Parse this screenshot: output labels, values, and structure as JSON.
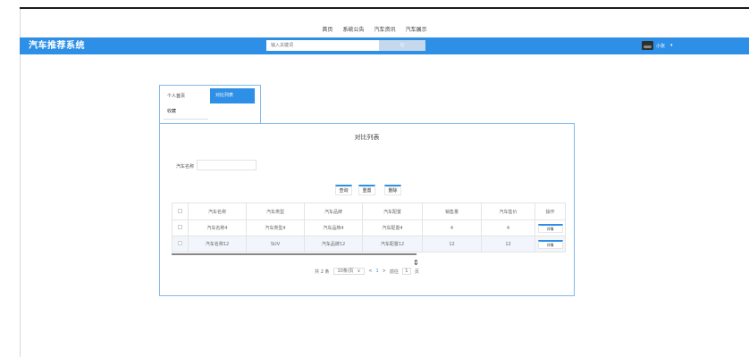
{
  "top_nav": {
    "items": [
      "首页",
      "系统公告",
      "汽车资讯",
      "汽车展示"
    ]
  },
  "header": {
    "brand": "汽车推荐系统",
    "search_placeholder": "输入关键词",
    "search_button": "Q",
    "user_name": "小张",
    "user_caret": "▾"
  },
  "side_tabs": {
    "profile": "个人首页",
    "compare": "对比列表",
    "favorites": "收藏"
  },
  "main": {
    "title": "对比列表",
    "filter_label": "汽车名称",
    "filter_value": "",
    "buttons": {
      "query": "查询",
      "reset": "重置",
      "delete": "删除"
    },
    "columns": [
      "",
      "汽车名称",
      "汽车类型",
      "汽车品牌",
      "汽车配置",
      "销售量",
      "汽车售价",
      "操作"
    ],
    "rows": [
      {
        "name": "汽车名称4",
        "type": "汽车类型4",
        "brand": "汽车品牌4",
        "config": "汽车配置4",
        "sales": "4",
        "price": "4",
        "action": "详情"
      },
      {
        "name": "汽车名称12",
        "type": "SUV",
        "brand": "汽车品牌12",
        "config": "汽车配置12",
        "sales": "12",
        "price": "12",
        "action": "详情"
      }
    ],
    "pagination": {
      "total": "共 2 条",
      "page_size": "10条/页",
      "prev": "<",
      "current": "1",
      "next": ">",
      "goto_label": "前往",
      "goto_value": "1",
      "page_suffix": "页"
    }
  },
  "colors": {
    "accent": "#2e8fe6",
    "border": "#7fb8ec"
  }
}
